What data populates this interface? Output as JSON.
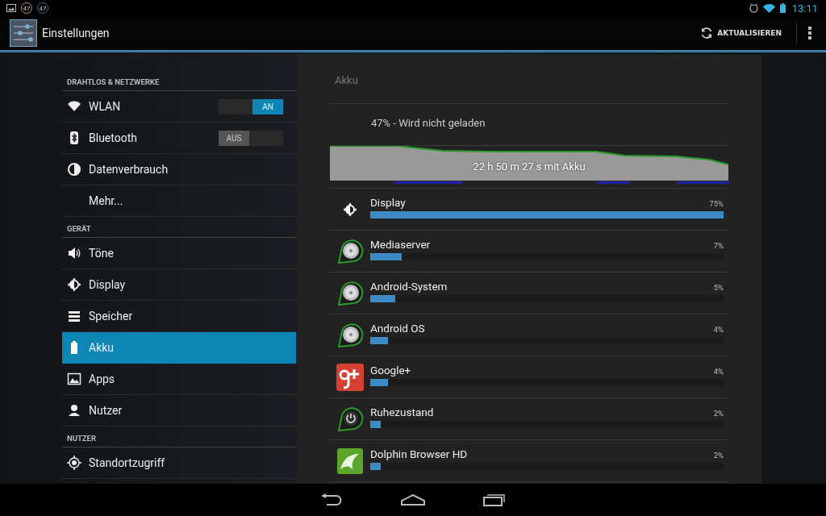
{
  "status_bar": {
    "notifications": [
      "47",
      "47"
    ],
    "time": "13:11"
  },
  "action_bar": {
    "title": "Einstellungen",
    "action": "AKTUALISIEREN"
  },
  "sidebar": {
    "items": [
      {
        "kind": "header",
        "label": "DRAHTLOS & NETZWERKE"
      },
      {
        "kind": "item",
        "label": "WLAN",
        "selected": false,
        "toggle": {
          "label": "AN",
          "on": true
        }
      },
      {
        "kind": "item",
        "label": "Bluetooth",
        "selected": false,
        "toggle": {
          "label": "AUS",
          "on": false
        }
      },
      {
        "kind": "item",
        "label": "Datenverbrauch",
        "selected": false
      },
      {
        "kind": "item",
        "label": "Mehr...",
        "selected": false
      },
      {
        "kind": "header",
        "label": "GERÄT"
      },
      {
        "kind": "item",
        "label": "Töne",
        "selected": false
      },
      {
        "kind": "item",
        "label": "Display",
        "selected": false
      },
      {
        "kind": "item",
        "label": "Speicher",
        "selected": false
      },
      {
        "kind": "item",
        "label": "Akku",
        "selected": true
      },
      {
        "kind": "item",
        "label": "Apps",
        "selected": false
      },
      {
        "kind": "item",
        "label": "Nutzer",
        "selected": false
      },
      {
        "kind": "header",
        "label": "NUTZER"
      },
      {
        "kind": "item",
        "label": "Standortzugriff",
        "selected": false
      }
    ]
  },
  "panel": {
    "title": "Akku",
    "status": "47% - Wird nicht geladen",
    "graph_label": "22 h 50 m 27 s mit Akku",
    "usage": [
      {
        "name": "Display",
        "percent": "75%",
        "level": 1.0
      },
      {
        "name": "Mediaserver",
        "percent": "7%",
        "level": 0.09
      },
      {
        "name": "Android-System",
        "percent": "5%",
        "level": 0.07
      },
      {
        "name": "Android OS",
        "percent": "4%",
        "level": 0.05
      },
      {
        "name": "Google+",
        "percent": "4%",
        "level": 0.05
      },
      {
        "name": "Ruhezustand",
        "percent": "2%",
        "level": 0.03
      },
      {
        "name": "Dolphin Browser HD",
        "percent": "2%",
        "level": 0.03
      }
    ]
  }
}
